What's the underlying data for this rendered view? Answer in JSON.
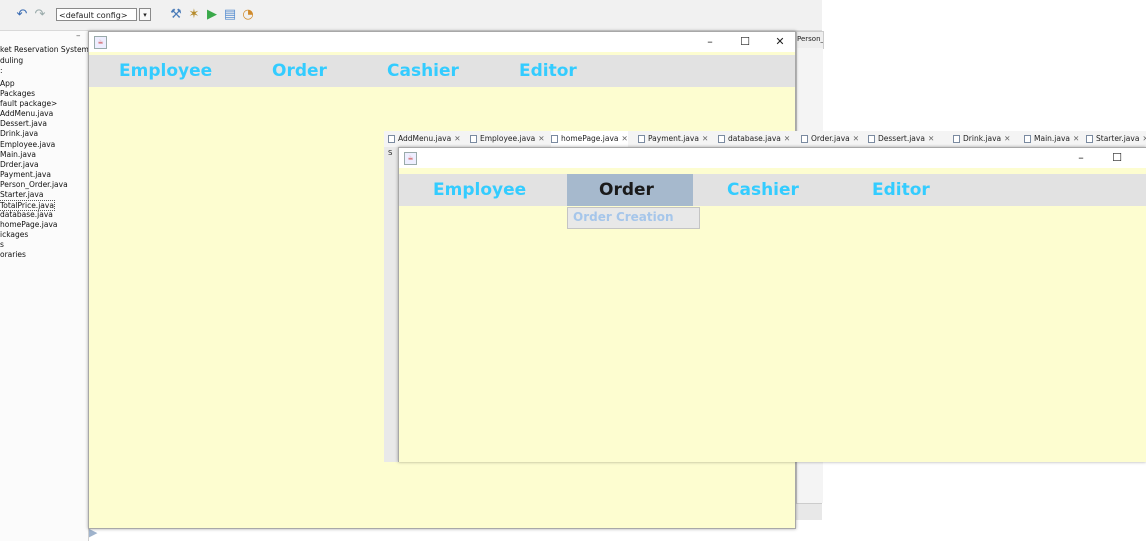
{
  "ide": {
    "config_select": "<default config>",
    "toolbar_icons": [
      "undo-icon",
      "redo-icon",
      "hammer-icon",
      "clean-build-icon",
      "run-icon",
      "debug-icon",
      "profile-icon"
    ],
    "projects_tree": [
      "ket Reservation System",
      "duling",
      ":",
      "App",
      " Packages",
      "fault package>",
      "AddMenu.java",
      "Dessert.java",
      "Drink.java",
      "Employee.java",
      "Main.java",
      "Drder.java",
      "Payment.java",
      "Person_Order.java",
      "Starter.java",
      "TotalPrice.java",
      "database.java",
      "homePage.java",
      "ickages",
      "s",
      "oraries"
    ],
    "selected_tree_item": "TotalPrice.java",
    "right_tab_label": "Person_C"
  },
  "back_window": {
    "menus": [
      "Employee",
      "Order",
      "Cashier",
      "Editor"
    ],
    "controls": {
      "minimize": "–",
      "maximize": "☐",
      "close": "✕"
    }
  },
  "front_window": {
    "editor_tabs": [
      {
        "label": "AddMenu.java",
        "active": false
      },
      {
        "label": "Employee.java",
        "active": false
      },
      {
        "label": "homePage.java",
        "active": true
      },
      {
        "label": "Payment.java",
        "active": false
      },
      {
        "label": "database.java",
        "active": false
      },
      {
        "label": "Order.java",
        "active": false
      },
      {
        "label": "Dessert.java",
        "active": false
      },
      {
        "label": "Drink.java",
        "active": false
      },
      {
        "label": "Main.java",
        "active": false
      },
      {
        "label": "Starter.java",
        "active": false
      }
    ],
    "menus": [
      "Employee",
      "Order",
      "Cashier",
      "Editor"
    ],
    "active_menu": "Order",
    "dropdown_items": [
      "Order Creation"
    ],
    "gutter_label": "S",
    "controls": {
      "minimize": "–",
      "maximize": "☐"
    }
  },
  "colors": {
    "menu_text": "#33ccff",
    "menu_active_bg": "#a6b9cd",
    "content_bg": "#fdfdd0",
    "menubar_bg": "#e2e2e2"
  }
}
